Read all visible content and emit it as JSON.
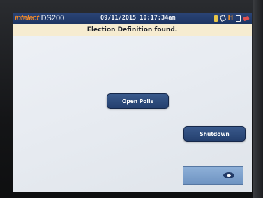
{
  "device": {
    "brand_logo": "intelect",
    "model": "DS200"
  },
  "header": {
    "datetime": "09/11/2015 10:17:34am",
    "status_icons": [
      "battery-icon",
      "usb-icon",
      "h-icon",
      "document-icon",
      "pen-icon"
    ]
  },
  "message": "Election Definition found.",
  "buttons": {
    "open_polls": "Open Polls",
    "shutdown": "Shutdown",
    "nav_icon": "eye-icon"
  },
  "colors": {
    "topbar": "#1d3562",
    "message_bar": "#f6ecd1",
    "button": "#2a4776",
    "nav_button": "#7fa2cf",
    "brand_accent": "#f08a2a"
  }
}
